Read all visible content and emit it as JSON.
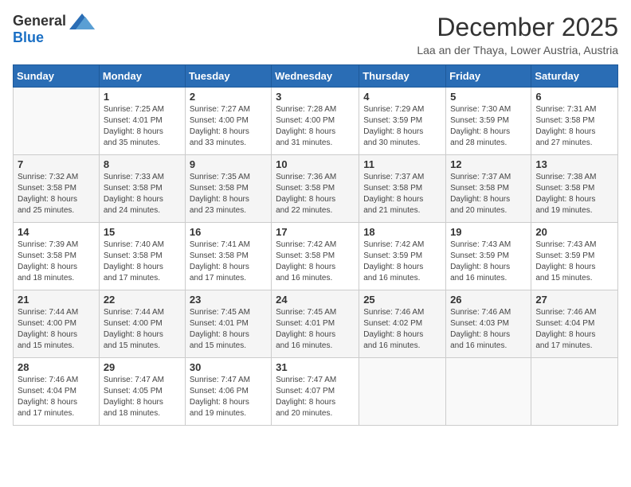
{
  "logo": {
    "general": "General",
    "blue": "Blue"
  },
  "title": "December 2025",
  "location": "Laa an der Thaya, Lower Austria, Austria",
  "days_of_week": [
    "Sunday",
    "Monday",
    "Tuesday",
    "Wednesday",
    "Thursday",
    "Friday",
    "Saturday"
  ],
  "weeks": [
    [
      {
        "day": "",
        "info": ""
      },
      {
        "day": "1",
        "info": "Sunrise: 7:25 AM\nSunset: 4:01 PM\nDaylight: 8 hours\nand 35 minutes."
      },
      {
        "day": "2",
        "info": "Sunrise: 7:27 AM\nSunset: 4:00 PM\nDaylight: 8 hours\nand 33 minutes."
      },
      {
        "day": "3",
        "info": "Sunrise: 7:28 AM\nSunset: 4:00 PM\nDaylight: 8 hours\nand 31 minutes."
      },
      {
        "day": "4",
        "info": "Sunrise: 7:29 AM\nSunset: 3:59 PM\nDaylight: 8 hours\nand 30 minutes."
      },
      {
        "day": "5",
        "info": "Sunrise: 7:30 AM\nSunset: 3:59 PM\nDaylight: 8 hours\nand 28 minutes."
      },
      {
        "day": "6",
        "info": "Sunrise: 7:31 AM\nSunset: 3:58 PM\nDaylight: 8 hours\nand 27 minutes."
      }
    ],
    [
      {
        "day": "7",
        "info": "Sunrise: 7:32 AM\nSunset: 3:58 PM\nDaylight: 8 hours\nand 25 minutes."
      },
      {
        "day": "8",
        "info": "Sunrise: 7:33 AM\nSunset: 3:58 PM\nDaylight: 8 hours\nand 24 minutes."
      },
      {
        "day": "9",
        "info": "Sunrise: 7:35 AM\nSunset: 3:58 PM\nDaylight: 8 hours\nand 23 minutes."
      },
      {
        "day": "10",
        "info": "Sunrise: 7:36 AM\nSunset: 3:58 PM\nDaylight: 8 hours\nand 22 minutes."
      },
      {
        "day": "11",
        "info": "Sunrise: 7:37 AM\nSunset: 3:58 PM\nDaylight: 8 hours\nand 21 minutes."
      },
      {
        "day": "12",
        "info": "Sunrise: 7:37 AM\nSunset: 3:58 PM\nDaylight: 8 hours\nand 20 minutes."
      },
      {
        "day": "13",
        "info": "Sunrise: 7:38 AM\nSunset: 3:58 PM\nDaylight: 8 hours\nand 19 minutes."
      }
    ],
    [
      {
        "day": "14",
        "info": "Sunrise: 7:39 AM\nSunset: 3:58 PM\nDaylight: 8 hours\nand 18 minutes."
      },
      {
        "day": "15",
        "info": "Sunrise: 7:40 AM\nSunset: 3:58 PM\nDaylight: 8 hours\nand 17 minutes."
      },
      {
        "day": "16",
        "info": "Sunrise: 7:41 AM\nSunset: 3:58 PM\nDaylight: 8 hours\nand 17 minutes."
      },
      {
        "day": "17",
        "info": "Sunrise: 7:42 AM\nSunset: 3:58 PM\nDaylight: 8 hours\nand 16 minutes."
      },
      {
        "day": "18",
        "info": "Sunrise: 7:42 AM\nSunset: 3:59 PM\nDaylight: 8 hours\nand 16 minutes."
      },
      {
        "day": "19",
        "info": "Sunrise: 7:43 AM\nSunset: 3:59 PM\nDaylight: 8 hours\nand 16 minutes."
      },
      {
        "day": "20",
        "info": "Sunrise: 7:43 AM\nSunset: 3:59 PM\nDaylight: 8 hours\nand 15 minutes."
      }
    ],
    [
      {
        "day": "21",
        "info": "Sunrise: 7:44 AM\nSunset: 4:00 PM\nDaylight: 8 hours\nand 15 minutes."
      },
      {
        "day": "22",
        "info": "Sunrise: 7:44 AM\nSunset: 4:00 PM\nDaylight: 8 hours\nand 15 minutes."
      },
      {
        "day": "23",
        "info": "Sunrise: 7:45 AM\nSunset: 4:01 PM\nDaylight: 8 hours\nand 15 minutes."
      },
      {
        "day": "24",
        "info": "Sunrise: 7:45 AM\nSunset: 4:01 PM\nDaylight: 8 hours\nand 16 minutes."
      },
      {
        "day": "25",
        "info": "Sunrise: 7:46 AM\nSunset: 4:02 PM\nDaylight: 8 hours\nand 16 minutes."
      },
      {
        "day": "26",
        "info": "Sunrise: 7:46 AM\nSunset: 4:03 PM\nDaylight: 8 hours\nand 16 minutes."
      },
      {
        "day": "27",
        "info": "Sunrise: 7:46 AM\nSunset: 4:04 PM\nDaylight: 8 hours\nand 17 minutes."
      }
    ],
    [
      {
        "day": "28",
        "info": "Sunrise: 7:46 AM\nSunset: 4:04 PM\nDaylight: 8 hours\nand 17 minutes."
      },
      {
        "day": "29",
        "info": "Sunrise: 7:47 AM\nSunset: 4:05 PM\nDaylight: 8 hours\nand 18 minutes."
      },
      {
        "day": "30",
        "info": "Sunrise: 7:47 AM\nSunset: 4:06 PM\nDaylight: 8 hours\nand 19 minutes."
      },
      {
        "day": "31",
        "info": "Sunrise: 7:47 AM\nSunset: 4:07 PM\nDaylight: 8 hours\nand 20 minutes."
      },
      {
        "day": "",
        "info": ""
      },
      {
        "day": "",
        "info": ""
      },
      {
        "day": "",
        "info": ""
      }
    ]
  ]
}
